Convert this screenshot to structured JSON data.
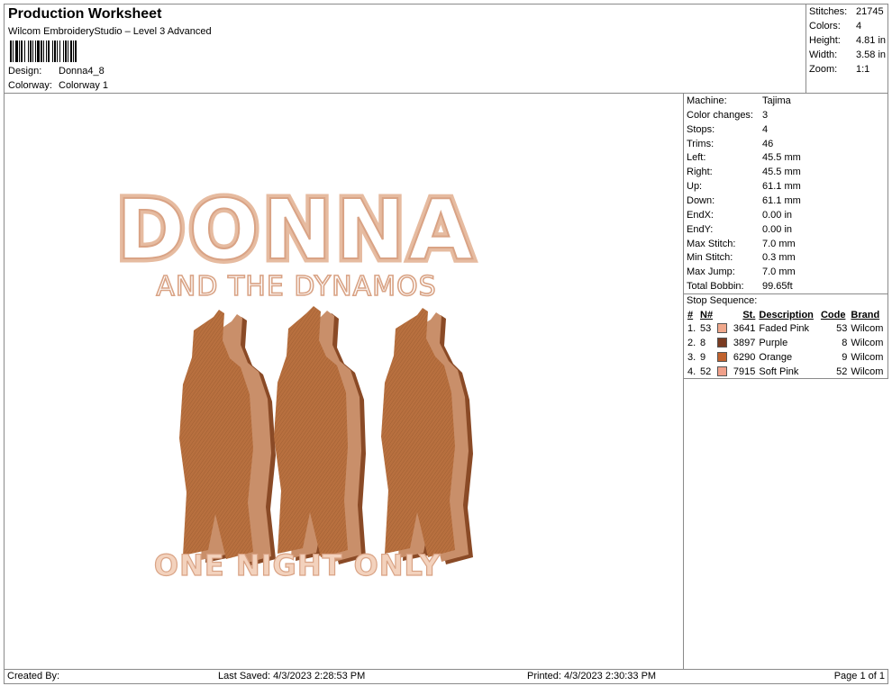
{
  "header": {
    "title": "Production Worksheet",
    "subtitle": "Wilcom EmbroideryStudio – Level 3 Advanced",
    "design_label": "Design:",
    "design_value": "Donna4_8",
    "colorway_label": "Colorway:",
    "colorway_value": "Colorway 1"
  },
  "stats": [
    {
      "label": "Stitches:",
      "value": "21745"
    },
    {
      "label": "Colors:",
      "value": "4"
    },
    {
      "label": "Height:",
      "value": "4.81 in"
    },
    {
      "label": "Width:",
      "value": "3.58 in"
    },
    {
      "label": "Zoom:",
      "value": "1:1"
    }
  ],
  "machine": [
    {
      "label": "Machine:",
      "value": "Tajima"
    },
    {
      "label": "Color changes:",
      "value": "3"
    },
    {
      "label": "Stops:",
      "value": "4"
    },
    {
      "label": "Trims:",
      "value": "46"
    },
    {
      "label": "Left:",
      "value": "45.5 mm"
    },
    {
      "label": "Right:",
      "value": "45.5 mm"
    },
    {
      "label": "Up:",
      "value": "61.1 mm"
    },
    {
      "label": "Down:",
      "value": "61.1 mm"
    },
    {
      "label": "EndX:",
      "value": "0.00 in"
    },
    {
      "label": "EndY:",
      "value": "0.00 in"
    },
    {
      "label": "Max Stitch:",
      "value": "7.0 mm"
    },
    {
      "label": "Min Stitch:",
      "value": "0.3 mm"
    },
    {
      "label": "Max Jump:",
      "value": "7.0 mm"
    },
    {
      "label": "Total Bobbin:",
      "value": "99.65ft"
    }
  ],
  "stop_sequence": {
    "title": "Stop Sequence:",
    "headers": {
      "num": "#",
      "n": "N#",
      "st": "St.",
      "description": "Description",
      "code": "Code",
      "brand": "Brand"
    },
    "rows": [
      {
        "num": "1.",
        "n": "53",
        "color": "#f0a88c",
        "st": "3641",
        "description": "Faded Pink",
        "code": "53",
        "brand": "Wilcom"
      },
      {
        "num": "2.",
        "n": "8",
        "color": "#7a3b22",
        "st": "3897",
        "description": "Purple",
        "code": "8",
        "brand": "Wilcom"
      },
      {
        "num": "3.",
        "n": "9",
        "color": "#c0622e",
        "st": "6290",
        "description": "Orange",
        "code": "9",
        "brand": "Wilcom"
      },
      {
        "num": "4.",
        "n": "52",
        "color": "#f0a08a",
        "st": "7915",
        "description": "Soft Pink",
        "code": "52",
        "brand": "Wilcom"
      }
    ]
  },
  "design": {
    "line1": "DONNA",
    "line2": "AND THE DYNAMOS",
    "line3": "ONE NIGHT ONLY",
    "color_light": "#e6bba0",
    "color_main": "#b8703f",
    "color_dark": "#8a4a26"
  },
  "footer": {
    "created_by": "Created By:",
    "last_saved": "Last Saved: 4/3/2023 2:28:53 PM",
    "printed": "Printed: 4/3/2023 2:30:33 PM",
    "page": "Page 1 of 1"
  }
}
